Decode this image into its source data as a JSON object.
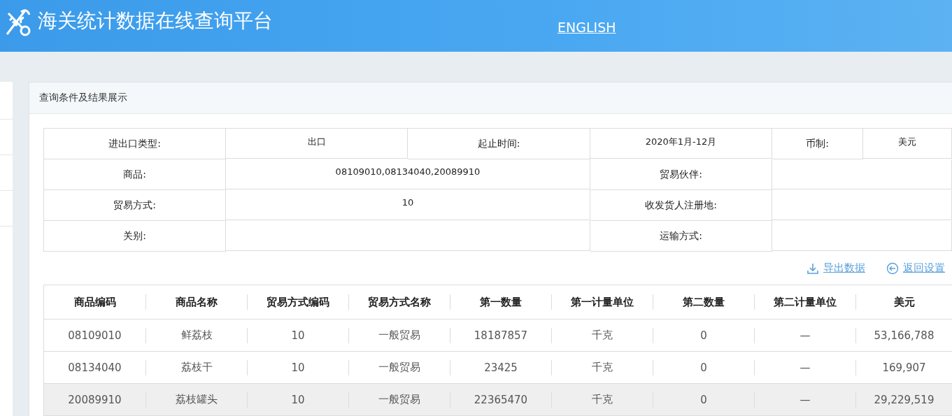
{
  "header": {
    "title": "海关统计数据在线查询平台",
    "language_link": "ENGLISH"
  },
  "panel": {
    "title": "查询条件及结果展示"
  },
  "conditions": [
    [
      {
        "kind": "label",
        "text": "进出口类型:"
      },
      {
        "kind": "value",
        "text": "出口"
      },
      {
        "kind": "label",
        "text": "起止时间:"
      },
      {
        "kind": "value",
        "text": "2020年1月-12月"
      },
      {
        "kind": "label",
        "text": "币制:"
      },
      {
        "kind": "value",
        "text": "美元"
      }
    ],
    [
      {
        "kind": "label",
        "text": "商品:"
      },
      {
        "kind": "value",
        "text": "08109010,08134040,20089910"
      },
      {
        "kind": "label",
        "text": "贸易伙伴:"
      },
      {
        "kind": "value"
      }
    ],
    [
      {
        "kind": "label",
        "text": "贸易方式:"
      },
      {
        "kind": "value",
        "text": "10"
      },
      {
        "kind": "label",
        "text": "收发货人注册地:"
      },
      {
        "kind": "value"
      }
    ],
    [
      {
        "kind": "label",
        "text": "关别:"
      },
      {
        "kind": "value"
      },
      {
        "kind": "label",
        "text": "运输方式:"
      },
      {
        "kind": "value"
      }
    ]
  ],
  "actions": [
    {
      "kind": "export",
      "label": "导出数据"
    },
    {
      "kind": "back",
      "label": "返回设置"
    }
  ],
  "table": {
    "columns": [
      "商品编码",
      "商品名称",
      "贸易方式编码",
      "贸易方式名称",
      "第一数量",
      "第一计量单位",
      "第二数量",
      "第二计量单位",
      "美元"
    ],
    "rows": [
      {
        "selected": false,
        "cells": [
          "08109010",
          "鲜荔枝",
          "10",
          "一般贸易",
          "18187857",
          "千克",
          "0",
          "—",
          "53,166,788"
        ]
      },
      {
        "selected": false,
        "cells": [
          "08134040",
          "荔枝干",
          "10",
          "一般贸易",
          "23425",
          "千克",
          "0",
          "—",
          "169,907"
        ]
      },
      {
        "selected": true,
        "cells": [
          "20089910",
          "荔枝罐头",
          "10",
          "一般贸易",
          "22365470",
          "千克",
          "0",
          "—",
          "29,229,519"
        ]
      }
    ]
  }
}
